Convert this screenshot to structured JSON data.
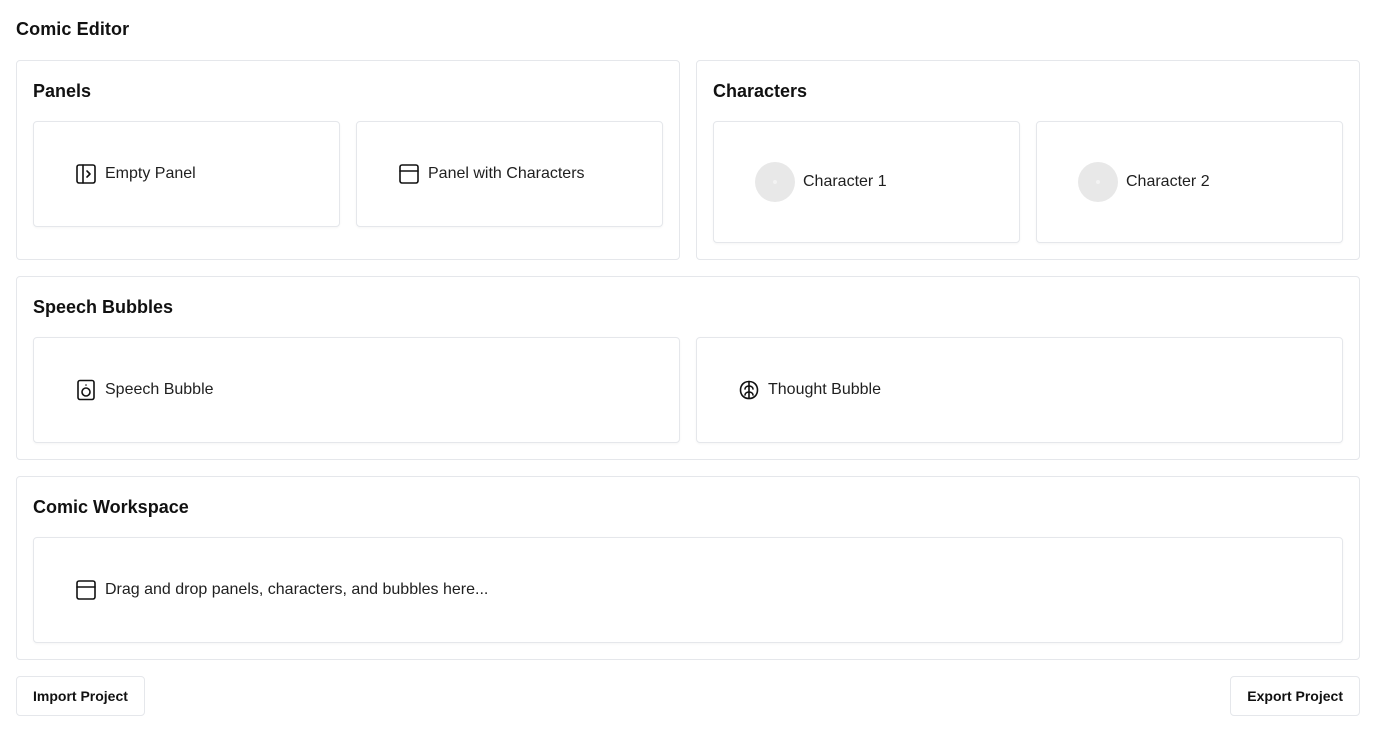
{
  "app": {
    "title": "Comic Editor"
  },
  "panels": {
    "title": "Panels",
    "items": [
      {
        "label": "Empty Panel",
        "icon": "panel-right-arrow-icon"
      },
      {
        "label": "Panel with Characters",
        "icon": "panel-layout-icon"
      }
    ]
  },
  "characters": {
    "title": "Characters",
    "items": [
      {
        "label": "Character 1",
        "icon": "avatar-placeholder"
      },
      {
        "label": "Character 2",
        "icon": "avatar-placeholder"
      }
    ]
  },
  "speech_bubbles": {
    "title": "Speech Bubbles",
    "items": [
      {
        "label": "Speech Bubble",
        "icon": "speaker-icon"
      },
      {
        "label": "Thought Bubble",
        "icon": "brain-icon"
      }
    ]
  },
  "workspace": {
    "title": "Comic Workspace",
    "placeholder": "Drag and drop panels, characters, and bubbles here...",
    "icon": "panel-layout-icon"
  },
  "footer": {
    "import_label": "Import Project",
    "export_label": "Export Project"
  },
  "colors": {
    "border": "#e5e7eb",
    "avatar": "#e8e8e8",
    "text": "#111111"
  }
}
